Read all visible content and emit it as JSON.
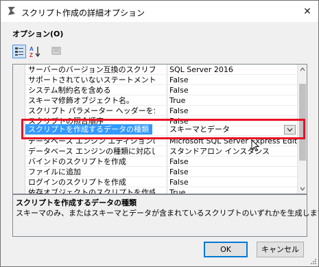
{
  "window": {
    "title": "スクリプト作成の詳細オプション",
    "close_glyph": "✕"
  },
  "group_label": "オプション(O)",
  "toolbar": {
    "categorized_icon": "categorized-view-icon",
    "alpha_icon": "alphabetical-sort-icon",
    "pages_icon": "property-pages-icon"
  },
  "grid": {
    "rows": [
      {
        "name": "サーバーのバージョン互換のスクリプト",
        "value": "SQL Server 2016"
      },
      {
        "name": "サポートされていないステートメントを含め",
        "value": "False"
      },
      {
        "name": "システム制約名を含める",
        "value": "False"
      },
      {
        "name": "スキーマ修飾オブジェクト名。",
        "value": "True"
      },
      {
        "name": "スクリプト パラメーター ヘッダーを含める",
        "value": "False"
      },
      {
        "name": "スクリプトの照合順序",
        "value": "False"
      },
      {
        "name": "スクリプトを作成するデータの種類",
        "value": "スキーマとデータ"
      },
      {
        "name": "データベース エンジン エディションのスク",
        "value": "Microsoft SQL Server Express Edition"
      },
      {
        "name": "データベース エンジンの種類に対応した",
        "value": "スタンドアロン インスタンス"
      },
      {
        "name": "バインドのスクリプトを作成",
        "value": "False"
      },
      {
        "name": "ファイルに追加",
        "value": "False"
      },
      {
        "name": "ログインのスクリプトを作成",
        "value": "False"
      },
      {
        "name": "依存オブジェクトのスクリプトを作成します",
        "value": "True"
      }
    ],
    "selected_index": 6
  },
  "description": {
    "title": "スクリプトを作成するデータの種類",
    "text": "スキーマのみ、またはスキーマとデータが含まれているスクリプトのいずれかを生成します。"
  },
  "buttons": {
    "ok": "OK",
    "cancel": "キャンセル"
  },
  "colors": {
    "selection": "#3399ff",
    "annotation": "#e81123",
    "default_button": "#0078d7"
  }
}
